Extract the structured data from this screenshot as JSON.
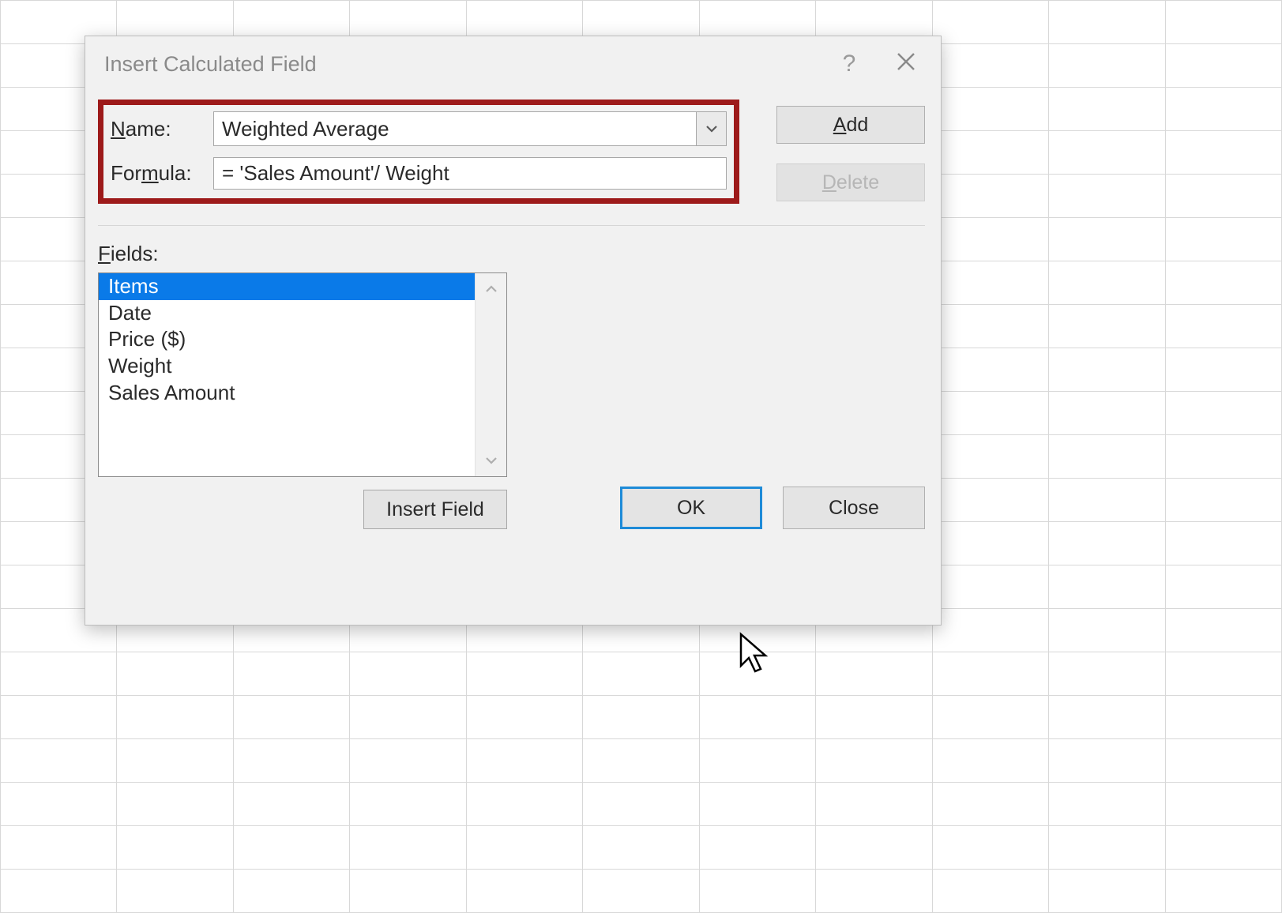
{
  "dialog": {
    "title": "Insert Calculated Field",
    "name_label_pre": "N",
    "name_label_post": "ame:",
    "name_value": "Weighted Average",
    "formula_label_pre": "For",
    "formula_label_u": "m",
    "formula_label_post": "ula:",
    "formula_value": "= 'Sales Amount'/ Weight",
    "add_btn_pre": "A",
    "add_btn_post": "dd",
    "delete_btn_pre": "D",
    "delete_btn_post": "elete",
    "fields_label_pre": "F",
    "fields_label_post": "ields:",
    "fields": [
      "Items",
      "Date",
      "Price ($)",
      "Weight",
      "Sales Amount"
    ],
    "selected_field_index": 0,
    "insert_field_btn": "Insert Field",
    "ok_btn": "OK",
    "close_btn": "Close"
  }
}
